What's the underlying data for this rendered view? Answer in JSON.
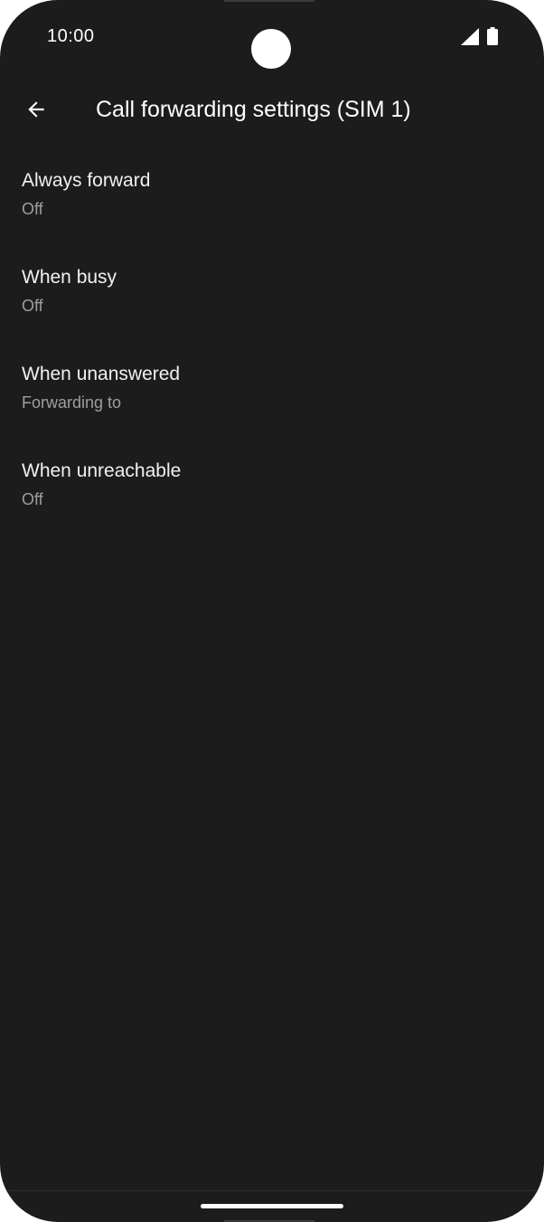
{
  "status_bar": {
    "time": "10:00",
    "icons": [
      "signal-icon",
      "battery-icon"
    ]
  },
  "app_bar": {
    "back_icon": "arrow-back-icon",
    "title": "Call forwarding settings (SIM 1)"
  },
  "settings": [
    {
      "title": "Always forward",
      "summary": "Off"
    },
    {
      "title": "When busy",
      "summary": "Off"
    },
    {
      "title": "When unanswered",
      "summary": "Forwarding to"
    },
    {
      "title": "When unreachable",
      "summary": "Off"
    }
  ],
  "colors": {
    "background": "#1c1c1c",
    "text_primary": "#f1f1f1",
    "text_secondary": "#9e9e9e"
  }
}
